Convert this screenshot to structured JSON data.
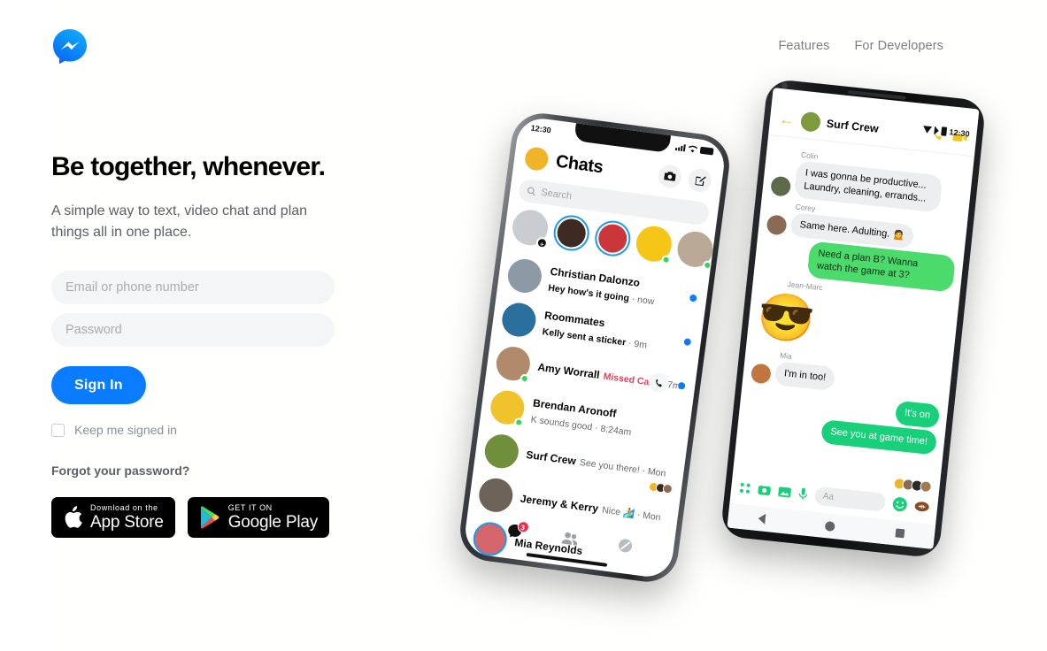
{
  "brand": {
    "logo_icon": "messenger-logo",
    "accent": "#0a7cff"
  },
  "nav": {
    "items": [
      {
        "label": "Features"
      },
      {
        "label": "For Developers"
      }
    ]
  },
  "hero": {
    "headline": "Be together, whenever.",
    "subhead": "A simple way to text, video chat and plan things all in one place."
  },
  "form": {
    "email_placeholder": "Email or phone number",
    "email_value": "",
    "password_placeholder": "Password",
    "password_value": "",
    "signin_label": "Sign In",
    "keep_signed_label": "Keep me signed in",
    "keep_signed_checked": false,
    "forgot_label": "Forgot your password?"
  },
  "badges": [
    {
      "icon": "apple-icon",
      "small": "Download on the",
      "large": "App Store"
    },
    {
      "icon": "google-play-icon",
      "small": "GET IT ON",
      "large": "Google Play"
    }
  ],
  "phone_ios": {
    "status_time": "12:30",
    "title": "Chats",
    "search_placeholder": "Search",
    "camera_icon": "camera-icon",
    "compose_icon": "compose-icon",
    "stories": [
      {
        "color": "#c9ccd0",
        "badge": "+",
        "ring": false,
        "online": false
      },
      {
        "color": "#3d2a22",
        "badge": "",
        "ring": true,
        "online": false
      },
      {
        "color": "#c9373a",
        "badge": "",
        "ring": true,
        "online": false
      },
      {
        "color": "#f5c518",
        "badge": "",
        "ring": false,
        "online": true
      },
      {
        "color": "#b9a996",
        "badge": "",
        "ring": false,
        "online": true
      },
      {
        "color": "#7d8a6b",
        "badge": "",
        "ring": false,
        "online": false
      }
    ],
    "chats": [
      {
        "name": "Christian Dalonzo",
        "preview": "Hey how's it going",
        "time": "now",
        "avatar": "#8d9aa6",
        "unread": true,
        "missed": false,
        "online": false
      },
      {
        "name": "Roommates",
        "preview": "Kelly sent a sticker",
        "time": "9m",
        "avatar": "#2b6f9e",
        "unread": true,
        "missed": false,
        "online": false
      },
      {
        "name": "Amy Worrall",
        "preview": "Missed Call",
        "time": "37m",
        "avatar": "#b08a6a",
        "unread": true,
        "missed": true,
        "online": true
      },
      {
        "name": "Brendan Aronoff",
        "preview": "K sounds good",
        "time": "8:24am",
        "avatar": "#f0c22b",
        "unread": false,
        "missed": false,
        "online": true
      },
      {
        "name": "Surf Crew",
        "preview": "See you there!",
        "time": "Mon",
        "avatar": "#6f8f3c",
        "unread": false,
        "missed": false,
        "online": false
      },
      {
        "name": "Jeremy & Kerry",
        "preview": "Nice 🏄",
        "time": "Mon",
        "avatar": "#6d6258",
        "unread": false,
        "missed": false,
        "online": false
      },
      {
        "name": "Mia Reynolds",
        "preview": "",
        "time": "",
        "avatar": "#d4656a",
        "unread": false,
        "missed": false,
        "online": false
      }
    ],
    "tabs": [
      {
        "icon": "chats-tab-icon",
        "badge": "3"
      },
      {
        "icon": "people-tab-icon",
        "badge": ""
      },
      {
        "icon": "discover-tab-icon",
        "badge": ""
      }
    ]
  },
  "phone_android": {
    "status_time": "12:30",
    "thread_title": "Surf Crew",
    "back_icon": "back-arrow-icon",
    "call_icon": "phone-call-icon",
    "video_icon": "video-call-icon",
    "messages": [
      {
        "sender": "Colin",
        "text": "I was gonna be productive... Laundry, cleaning, errands...",
        "type": "in",
        "avatar": "#5e6b4a"
      },
      {
        "sender": "Corey",
        "text": "Same here. Adulting. 🙍",
        "type": "in",
        "avatar": "#8a6a52"
      },
      {
        "sender": "",
        "text": "Need a plan B? Wanna watch the game at 3?",
        "type": "out-green",
        "avatar": ""
      },
      {
        "sender": "Jean-Marc",
        "text": "😎",
        "type": "sticker",
        "avatar": ""
      },
      {
        "sender": "Mia",
        "text": "I'm in too!",
        "type": "in",
        "avatar": "#c2763f"
      },
      {
        "sender": "",
        "text": "It's on",
        "type": "out-green2",
        "avatar": ""
      },
      {
        "sender": "",
        "text": "See you at game time!",
        "type": "out-green2",
        "avatar": ""
      }
    ],
    "input": {
      "placeholder": "Aa",
      "icons": [
        "apps-grid-icon",
        "camera-icon",
        "gallery-icon",
        "microphone-icon"
      ],
      "emoji_icon": "smiley-icon",
      "sticker_icon": "football-sticker"
    },
    "nav_icons": [
      "back-nav-icon",
      "home-nav-icon",
      "recents-nav-icon"
    ]
  }
}
